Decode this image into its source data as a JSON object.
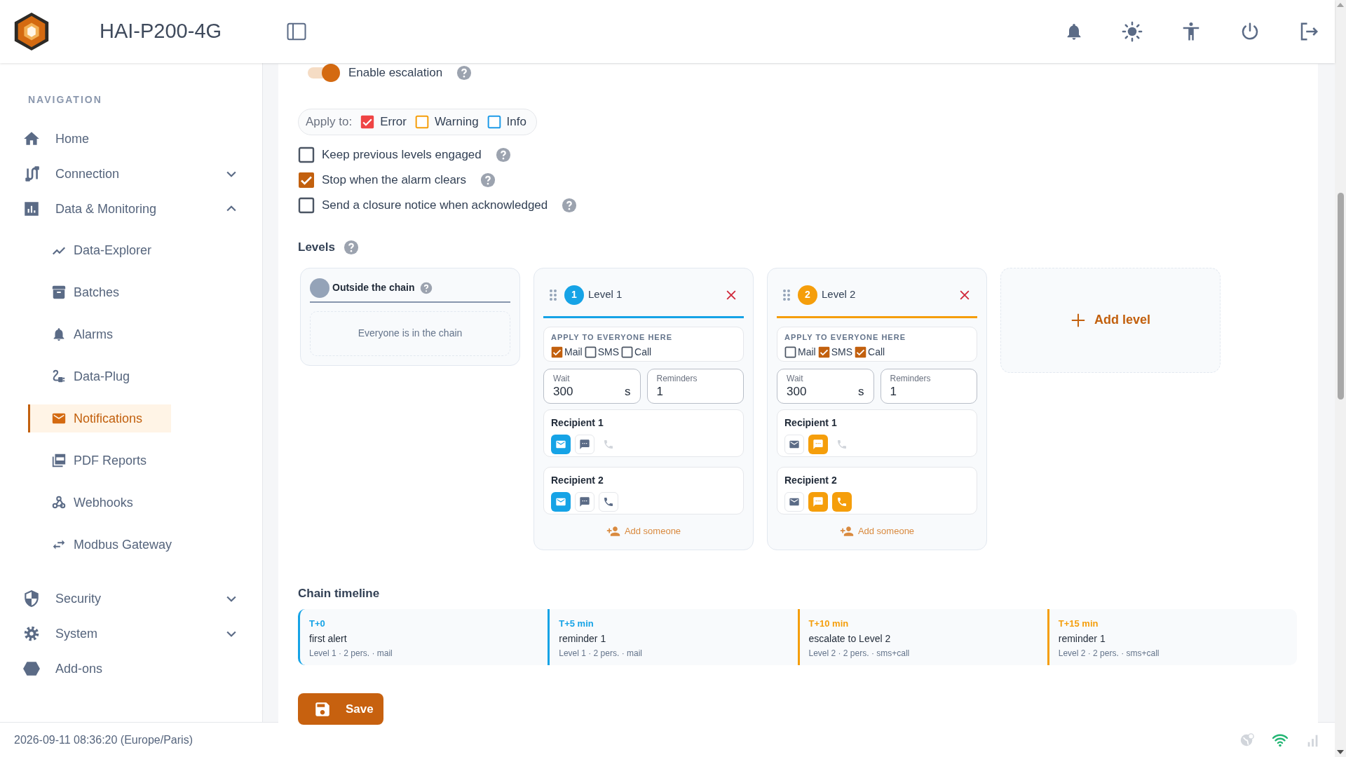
{
  "header": {
    "title": "HAI-P200-4G"
  },
  "sidebar": {
    "heading": "NAVIGATION",
    "items": [
      {
        "label": "Home",
        "selected": false
      },
      {
        "label": "Connection",
        "selected": false,
        "expanded": false
      },
      {
        "label": "Data & Monitoring",
        "selected": false,
        "expanded": true,
        "children": [
          {
            "label": "Data-Explorer",
            "selected": false
          },
          {
            "label": "Batches",
            "selected": false
          },
          {
            "label": "Alarms",
            "selected": false
          },
          {
            "label": "Data-Plug",
            "selected": false
          },
          {
            "label": "Notifications",
            "selected": true
          },
          {
            "label": "PDF Reports",
            "selected": false
          },
          {
            "label": "Webhooks",
            "selected": false
          },
          {
            "label": "Modbus Gateway",
            "selected": false
          }
        ]
      },
      {
        "label": "Security",
        "selected": false,
        "expanded": false
      },
      {
        "label": "System",
        "selected": false,
        "expanded": false
      },
      {
        "label": "Add-ons",
        "selected": false
      }
    ]
  },
  "escalation": {
    "label": "Enable escalation",
    "on": true
  },
  "apply_to": {
    "label": "Apply to:",
    "options": [
      {
        "label": "Error",
        "checked": true,
        "color": "#ef4444"
      },
      {
        "label": "Warning",
        "checked": false,
        "color": "#f59e0b"
      },
      {
        "label": "Info",
        "checked": false,
        "color": "#1e9be8"
      }
    ]
  },
  "options": [
    {
      "label": "Keep previous levels engaged",
      "checked": false
    },
    {
      "label": "Stop when the alarm clears",
      "checked": true
    },
    {
      "label": "Send a closure notice when acknowledged",
      "checked": false
    }
  ],
  "levels_heading": "Levels",
  "outside": {
    "title": "Outside the chain",
    "empty_text": "Everyone is in the chain"
  },
  "levels": [
    {
      "badge": "1",
      "title": "Level 1",
      "color": "#16a3e6",
      "apply_heading": "APPLY TO EVERYONE HERE",
      "channels": [
        {
          "label": "Mail",
          "checked": true
        },
        {
          "label": "SMS",
          "checked": false
        },
        {
          "label": "Call",
          "checked": false
        }
      ],
      "wait": {
        "label": "Wait",
        "value": "300",
        "unit": "s"
      },
      "reminders": {
        "label": "Reminders",
        "value": "1"
      },
      "recipients": [
        {
          "name": "Recipient 1",
          "channels": [
            {
              "kind": "mail",
              "on": true,
              "disabled": false
            },
            {
              "kind": "sms",
              "on": false,
              "disabled": false
            },
            {
              "kind": "call",
              "on": false,
              "disabled": true
            }
          ]
        },
        {
          "name": "Recipient 2",
          "channels": [
            {
              "kind": "mail",
              "on": true,
              "disabled": false
            },
            {
              "kind": "sms",
              "on": false,
              "disabled": false
            },
            {
              "kind": "call",
              "on": false,
              "disabled": false
            }
          ]
        }
      ],
      "add_label": "Add someone"
    },
    {
      "badge": "2",
      "title": "Level 2",
      "color": "#f59e0b",
      "apply_heading": "APPLY TO EVERYONE HERE",
      "channels": [
        {
          "label": "Mail",
          "checked": false
        },
        {
          "label": "SMS",
          "checked": true
        },
        {
          "label": "Call",
          "checked": true
        }
      ],
      "wait": {
        "label": "Wait",
        "value": "300",
        "unit": "s"
      },
      "reminders": {
        "label": "Reminders",
        "value": "1"
      },
      "recipients": [
        {
          "name": "Recipient 1",
          "channels": [
            {
              "kind": "mail",
              "on": false,
              "disabled": false
            },
            {
              "kind": "sms",
              "on": true,
              "disabled": false
            },
            {
              "kind": "call",
              "on": false,
              "disabled": true
            }
          ]
        },
        {
          "name": "Recipient 2",
          "channels": [
            {
              "kind": "mail",
              "on": false,
              "disabled": false
            },
            {
              "kind": "sms",
              "on": true,
              "disabled": false
            },
            {
              "kind": "call",
              "on": true,
              "disabled": false
            }
          ]
        }
      ],
      "add_label": "Add someone"
    }
  ],
  "add_level": "Add level",
  "timeline": {
    "heading": "Chain timeline",
    "events": [
      {
        "time": "T+0",
        "title": "first alert",
        "detail": "Level 1 · 2 pers. · mail",
        "color": "#16a3e6"
      },
      {
        "time": "T+5 min",
        "title": "reminder 1",
        "detail": "Level 1 · 2 pers. · mail",
        "color": "#16a3e6"
      },
      {
        "time": "T+10 min",
        "title": "escalate to Level 2",
        "detail": "Level 2 · 2 pers. · sms+call",
        "color": "#f59e0b"
      },
      {
        "time": "T+15 min",
        "title": "reminder 1",
        "detail": "Level 2 · 2 pers. · sms+call",
        "color": "#f59e0b"
      }
    ]
  },
  "save": "Save",
  "footer": {
    "timestamp": "2026-09-11 08:36:20 (Europe/Paris)"
  }
}
